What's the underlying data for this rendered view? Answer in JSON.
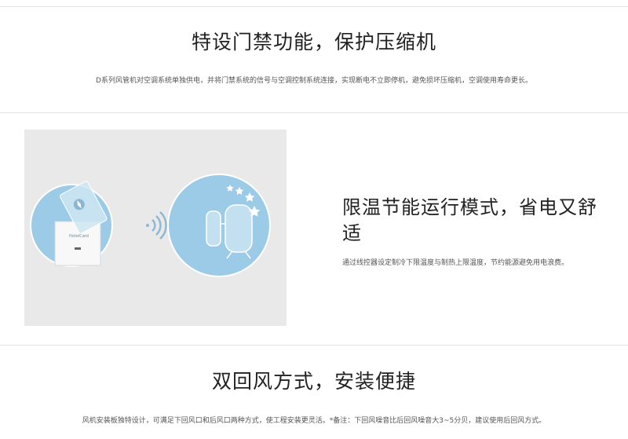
{
  "section1": {
    "title": "特设门禁功能，保护压缩机",
    "description": "D系列风管机对空调系统单独供电，并将门禁系统的信号与空调控制系统连接，实现断电不立即停机，避免损坏压缩机，空调使用寿命更长。"
  },
  "section2": {
    "title": "限温节能运行模式，省电又舒适",
    "description": "通过线控器设定制冷下限温度与制热上限温度，节约能源避免用电浪费。",
    "card_label": "HotelCard"
  },
  "section3": {
    "title": "双回风方式，安装便捷",
    "description": "风机安装板独特设计，可满足下回风口和后风口两种方式，使工程安装更灵活。*备注：下回风噪音比后回风噪音大3~5分贝，建议使用后回风方式。"
  },
  "colors": {
    "circle_fill": "#9ccbe7",
    "panel_bg": "#e9e9e9",
    "divider": "#e3e3e3"
  }
}
